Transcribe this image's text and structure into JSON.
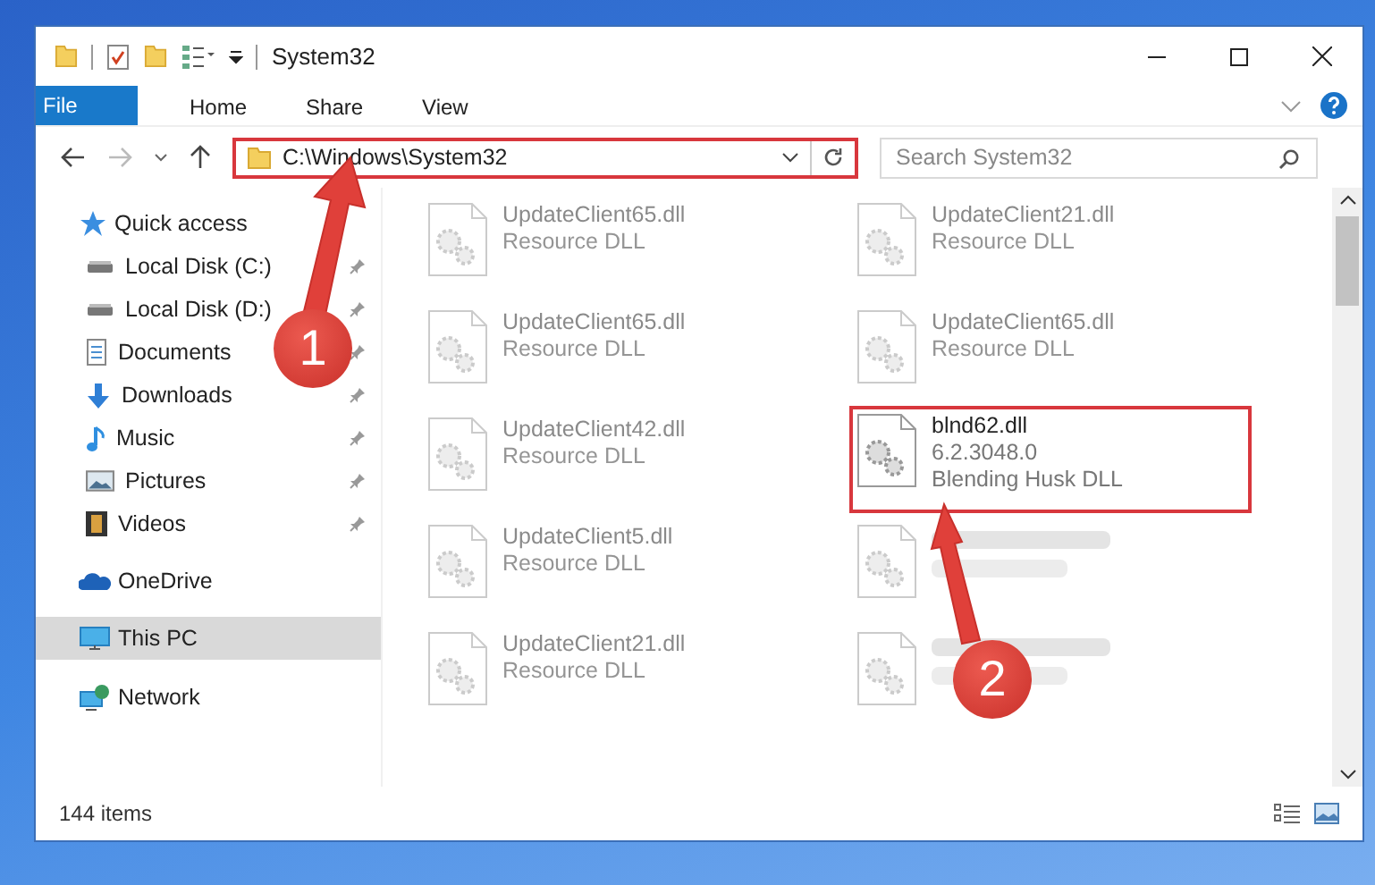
{
  "window": {
    "title": "System32"
  },
  "file_menu": {
    "label": "File"
  },
  "ribbon_tabs": [
    {
      "label": "Home",
      "selected": false
    },
    {
      "label": "Share",
      "selected": false
    },
    {
      "label": "View",
      "selected": false
    }
  ],
  "address": {
    "path": "C:\\Windows\\System32",
    "highlighted": true
  },
  "search": {
    "placeholder": "Search System32"
  },
  "sidebar": {
    "items": [
      {
        "label": "Quick access",
        "kind": "star",
        "selected": false,
        "children": [
          {
            "label": "Local Disk (C:)",
            "kind": "disk",
            "pinned": true,
            "selected": false
          },
          {
            "label": "Local Disk (D:)",
            "kind": "disk",
            "pinned": true,
            "selected": false
          },
          {
            "label": "Documents",
            "kind": "document",
            "pinned": true,
            "selected": false
          },
          {
            "label": "Downloads",
            "kind": "download",
            "pinned": true,
            "selected": false
          },
          {
            "label": "Music",
            "kind": "music",
            "pinned": true,
            "selected": false
          },
          {
            "label": "Pictures",
            "kind": "pictures",
            "pinned": true,
            "selected": false
          },
          {
            "label": "Videos",
            "kind": "videos",
            "pinned": true,
            "selected": false
          }
        ]
      },
      {
        "label": "OneDrive",
        "kind": "cloud",
        "selected": false
      },
      {
        "label": "This PC",
        "kind": "pc",
        "selected": true
      },
      {
        "label": "Network",
        "kind": "network",
        "selected": false
      }
    ]
  },
  "files": [
    {
      "kind": "faded",
      "name": "UpdateClient65.dll",
      "description": "Resource DLL",
      "highlighted": false
    },
    {
      "kind": "faded",
      "name": "UpdateClient21.dll",
      "description": "Resource DLL",
      "highlighted": false
    },
    {
      "kind": "faded",
      "name": "UpdateClient65.dll",
      "description": "Resource DLL",
      "highlighted": false
    },
    {
      "kind": "faded",
      "name": "UpdateClient65.dll",
      "description": "Resource DLL",
      "highlighted": false
    },
    {
      "kind": "faded",
      "name": "UpdateClient42.dll",
      "description": "Resource DLL",
      "highlighted": false
    },
    {
      "kind": "file",
      "name": "blnd62.dll",
      "version": "6.2.3048.0",
      "description": "Blending Husk DLL",
      "highlighted": true
    },
    {
      "kind": "faded",
      "name": "UpdateClient5.dll",
      "description": "Resource DLL",
      "highlighted": false
    },
    {
      "kind": "obscured"
    },
    {
      "kind": "faded",
      "name": "UpdateClient21.dll",
      "description": "Resource DLL",
      "highlighted": false
    },
    {
      "kind": "obscured"
    }
  ],
  "callouts": [
    {
      "number": "1"
    },
    {
      "number": "2"
    }
  ],
  "status_bar": {
    "item_count": "144 items"
  }
}
